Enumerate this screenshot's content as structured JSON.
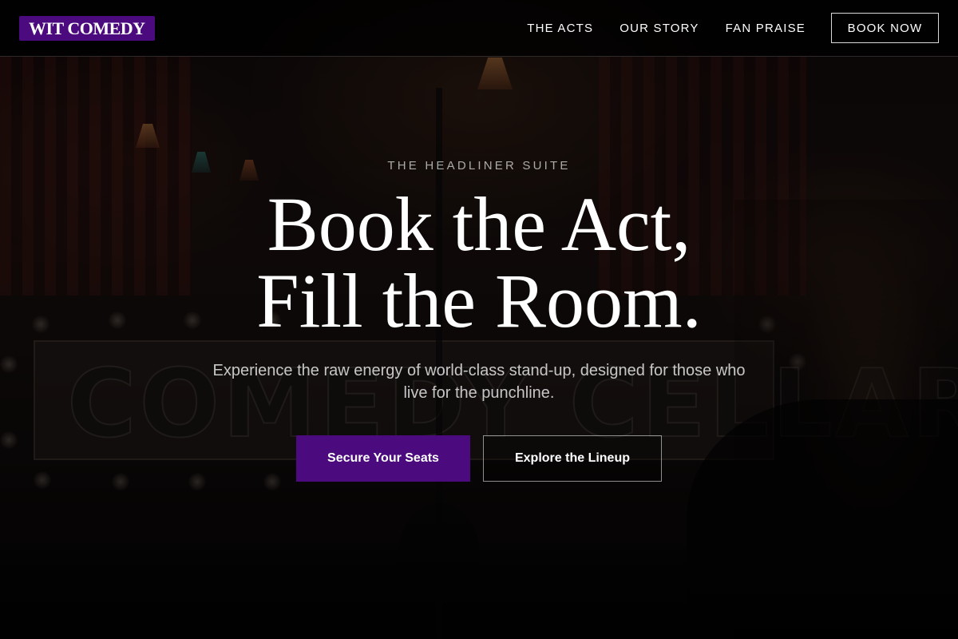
{
  "brand": {
    "logo_text": "WIT COMEDY",
    "accent_color": "#4b0a7d"
  },
  "nav": {
    "links": [
      "THE ACTS",
      "OUR STORY",
      "FAN PRAISE"
    ],
    "cta_label": "BOOK NOW"
  },
  "hero": {
    "backdrop_sign_text": "COMEDY CELLAR",
    "eyebrow": "THE HEADLINER SUITE",
    "headline_line1": "Book the Act,",
    "headline_line2": "Fill the Room.",
    "subtext": "Experience the raw energy of world-class stand-up, designed for those who live for the punchline.",
    "primary_button": "Secure Your Seats",
    "secondary_button": "Explore the Lineup"
  }
}
